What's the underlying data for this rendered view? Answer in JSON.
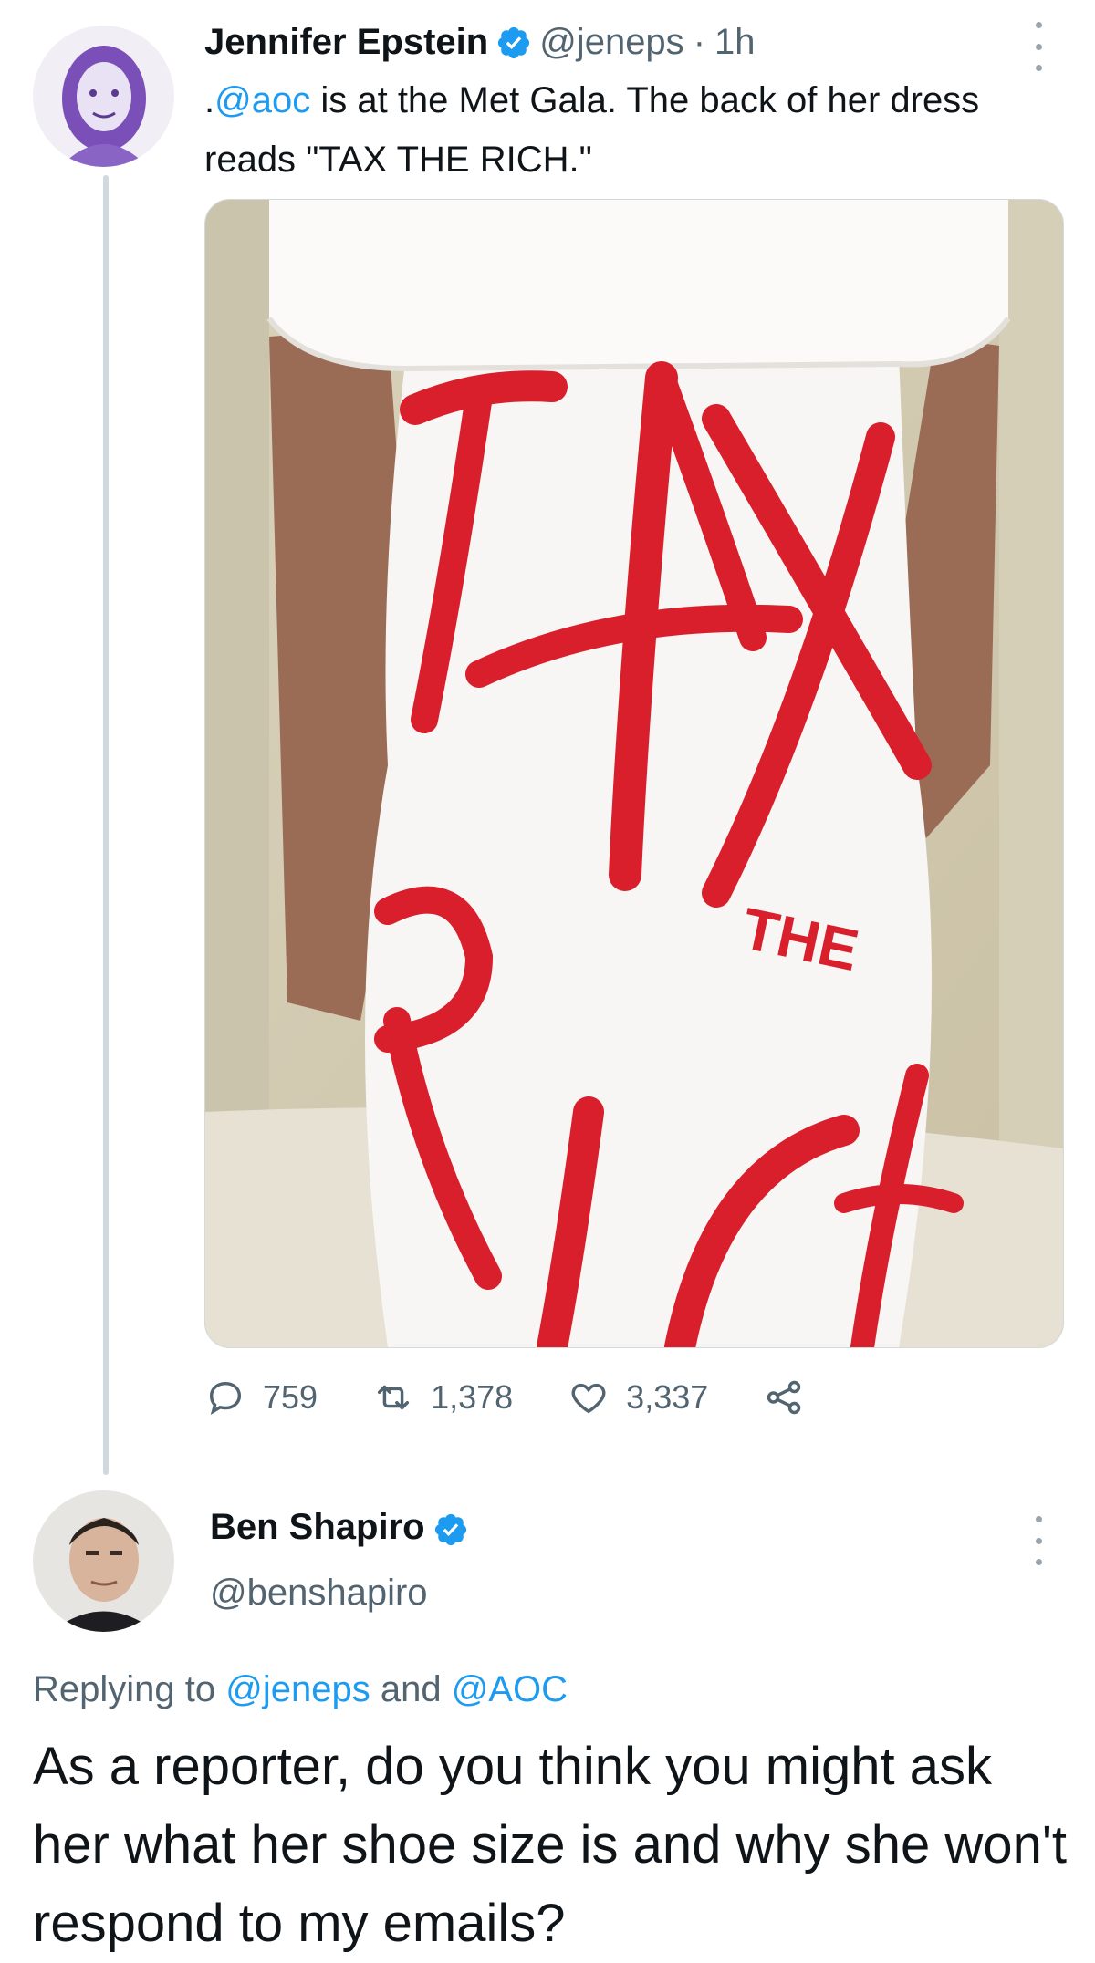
{
  "tweet1": {
    "author_name": "Jennifer Epstein",
    "handle": "@jeneps",
    "separator": "·",
    "time": "1h",
    "text_prefix": ".",
    "mention": "@aoc",
    "text_rest": " is at the Met Gala. The back of her dress reads \"TAX THE RICH.\"",
    "media_icon": "dress-photo",
    "stats": {
      "replies": "759",
      "retweets": "1,378",
      "likes": "3,337"
    }
  },
  "tweet2": {
    "author_name": "Ben Shapiro",
    "handle": "@benshapiro",
    "replying_label": "Replying to ",
    "reply_mention_1": "@jeneps",
    "reply_and": " and ",
    "reply_mention_2": "@AOC",
    "text": "As a reporter, do you think you might ask her what her shoe size is and why she won't respond to my emails?"
  },
  "colors": {
    "accent": "#1d9bf0",
    "secondary_text": "#536471",
    "dress_red": "#d81f2b"
  }
}
